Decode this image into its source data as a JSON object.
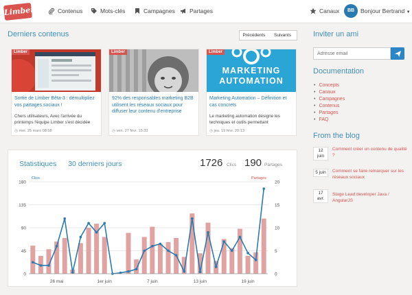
{
  "brand": {
    "logo_text": "Limber",
    "accent": "#2a7ab0",
    "red": "#d9534f"
  },
  "nav": {
    "items": [
      {
        "label": "Contenus",
        "icon": "paperclip-icon"
      },
      {
        "label": "Mots-clés",
        "icon": "tags-icon"
      },
      {
        "label": "Campagnes",
        "icon": "bookmark-icon"
      },
      {
        "label": "Partages",
        "icon": "megaphone-icon"
      }
    ],
    "channels_label": "Canaux",
    "user": {
      "initials": "BB",
      "greeting": "Bonjour Bertrand"
    }
  },
  "latest": {
    "title": "Derniers contenus",
    "prev_label": "Précédents",
    "next_label": "Suivants",
    "cards": [
      {
        "tag": "Limber",
        "title": "Sortie de Limber Bêta-3 : démultipliez vos partages sociaux !",
        "text": "Chers utilisateurs, Avec l'arrivée du printemps l'équipe Limber s'est décidée",
        "date": "mer. 25 mars 08:58"
      },
      {
        "tag": "Limber",
        "title": "92% des responsables marketing B2B utilisent les réseaux sociaux pour diffuser leur contenu d'entreprise",
        "text": "",
        "date": "ven. 27 févr. 15:33"
      },
      {
        "tag": "Limber",
        "title": "Marketing Automation – Définition et cas concrets",
        "text": "Le marketing automation désigne les techniques et outils permettant",
        "date": "jeu. 19 févr. 20:13",
        "image_text": "MARKETING AUTOMATION"
      }
    ]
  },
  "invite": {
    "title": "Inviter un ami",
    "placeholder": "Adresse email"
  },
  "documentation": {
    "title": "Documentation",
    "links": [
      "Concepts",
      "Canaux",
      "Campagnes",
      "Contenus",
      "Partages",
      "FAQ"
    ]
  },
  "blog": {
    "title": "From the blog",
    "posts": [
      {
        "day": "12",
        "month": "juin",
        "title": "Comment créer un contenu de qualité ?"
      },
      {
        "day": "5 juin",
        "month": "",
        "title": "Comment se faire remarquer sur les réseaux sociaux"
      },
      {
        "day": "17",
        "month": "avr.",
        "title": "Stage Lead developer Java / AngularJS"
      }
    ]
  },
  "stats": {
    "title": "Statistiques",
    "period": "30 derniers jours",
    "clicks_total": "1726",
    "clicks_label": "Clics",
    "shares_total": "190",
    "shares_label": "Partages"
  },
  "chart_data": {
    "type": "bar",
    "series": [
      {
        "name": "Clics",
        "axis": "left",
        "values": [
          55,
          35,
          48,
          63,
          70,
          8,
          60,
          90,
          98,
          72,
          0,
          0,
          80,
          28,
          72,
          92,
          58,
          62,
          70,
          33,
          118,
          40,
          100,
          25,
          68,
          50,
          88,
          35,
          42,
          108
        ]
      },
      {
        "name": "Partages",
        "axis": "right",
        "values": [
          2.5,
          1.8,
          1.8,
          6,
          12,
          0.3,
          8,
          11,
          9,
          11,
          0,
          0.2,
          0.5,
          1,
          5,
          6,
          6.5,
          5,
          4,
          0.5,
          12,
          0.4,
          9,
          1.5,
          7,
          5,
          8,
          4.5,
          3,
          18.5
        ]
      }
    ],
    "y_left_ticks": [
      0,
      45,
      90,
      135,
      180
    ],
    "y_right_ticks": [
      0,
      5,
      10,
      15,
      20
    ],
    "ylim_left": [
      0,
      180
    ],
    "ylim_right": [
      0,
      20
    ],
    "x_ticks": [
      {
        "index": 3,
        "label": "26 mai"
      },
      {
        "index": 9,
        "label": "1er juin"
      },
      {
        "index": 15,
        "label": "7 juin"
      },
      {
        "index": 21,
        "label": "13 juin"
      },
      {
        "index": 27,
        "label": "19 juin"
      }
    ],
    "bar_color": "#e0a3a1",
    "line_color": "#2a7ab0",
    "grid": true
  }
}
